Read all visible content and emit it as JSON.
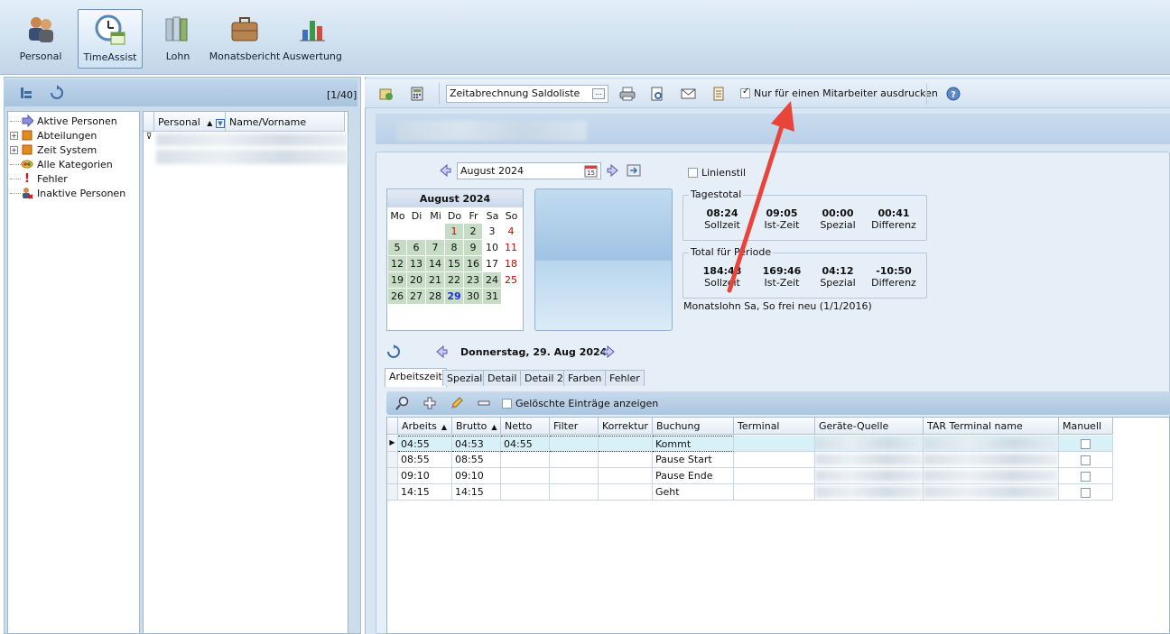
{
  "modules": [
    {
      "label": "Personal",
      "icon": "people-icon"
    },
    {
      "label": "TimeAssist",
      "icon": "clock-calendar-icon"
    },
    {
      "label": "Lohn",
      "icon": "binders-icon"
    },
    {
      "label": "Monatsbericht",
      "icon": "briefcase-icon"
    },
    {
      "label": "Auswertung",
      "icon": "bar-chart-icon"
    }
  ],
  "left": {
    "counter": "[1/40]",
    "tree": [
      "Aktive Personen",
      "Abteilungen",
      "Zeit System",
      "Alle Kategorien",
      "Fehler",
      "Inaktive Personen"
    ],
    "grid_headers": [
      "Personal",
      "Name/Vorname"
    ]
  },
  "toolbar": {
    "report": "Zeitabrechnung Saldoliste",
    "report_btn": "...",
    "checkbox_label": "Nur für einen Mitarbeiter ausdrucken",
    "checked": true
  },
  "calendar": {
    "month_input": "August 2024",
    "title": "August 2024",
    "weekdays": [
      "Mo",
      "Di",
      "Mi",
      "Do",
      "Fr",
      "Sa",
      "So"
    ],
    "weeks": [
      [
        "",
        "",
        "",
        "1",
        "2",
        "3",
        "4"
      ],
      [
        "5",
        "6",
        "7",
        "8",
        "9",
        "10",
        "11"
      ],
      [
        "12",
        "13",
        "14",
        "15",
        "16",
        "17",
        "18"
      ],
      [
        "19",
        "20",
        "21",
        "22",
        "23",
        "24",
        "25"
      ],
      [
        "26",
        "27",
        "28",
        "29",
        "30",
        "31",
        ""
      ]
    ],
    "linienstil": "Linienstil"
  },
  "tagestotal": {
    "title": "Tagestotal",
    "items": [
      {
        "v": "08:24",
        "l": "Sollzeit"
      },
      {
        "v": "09:05",
        "l": "Ist-Zeit"
      },
      {
        "v": "00:00",
        "l": "Spezial"
      },
      {
        "v": "00:41",
        "l": "Differenz"
      }
    ]
  },
  "periode": {
    "title": "Total für Periode",
    "items": [
      {
        "v": "184:48",
        "l": "Sollzeit"
      },
      {
        "v": "169:46",
        "l": "Ist-Zeit"
      },
      {
        "v": "04:12",
        "l": "Spezial"
      },
      {
        "v": "-10:50",
        "l": "Differenz"
      }
    ]
  },
  "monatslohn": "Monatslohn Sa, So frei neu (1/1/2016)",
  "day_title": "Donnerstag, 29. Aug 2024",
  "tabs": [
    "Arbeitszeit",
    "Spezial",
    "Detail",
    "Detail 2",
    "Farben",
    "Fehler"
  ],
  "show_deleted": "Gelöschte Einträge anzeigen",
  "grid": {
    "headers": [
      "Arbeits",
      "Brutto",
      "Netto",
      "Filter",
      "Korrektur",
      "Buchung",
      "Terminal",
      "Geräte-Quelle",
      "TAR Terminal name",
      "Manuell"
    ],
    "rows": [
      [
        "04:55",
        "04:53",
        "04:55",
        "",
        "",
        "Kommt"
      ],
      [
        "08:55",
        "08:55",
        "",
        "",
        "",
        "Pause Start"
      ],
      [
        "09:10",
        "09:10",
        "",
        "",
        "",
        "Pause Ende"
      ],
      [
        "14:15",
        "14:15",
        "",
        "",
        "",
        "Geht"
      ]
    ]
  },
  "colors": {
    "accent": "#e8443a",
    "highlight_day": "#c6dcc4",
    "sunday": "#d00000"
  }
}
